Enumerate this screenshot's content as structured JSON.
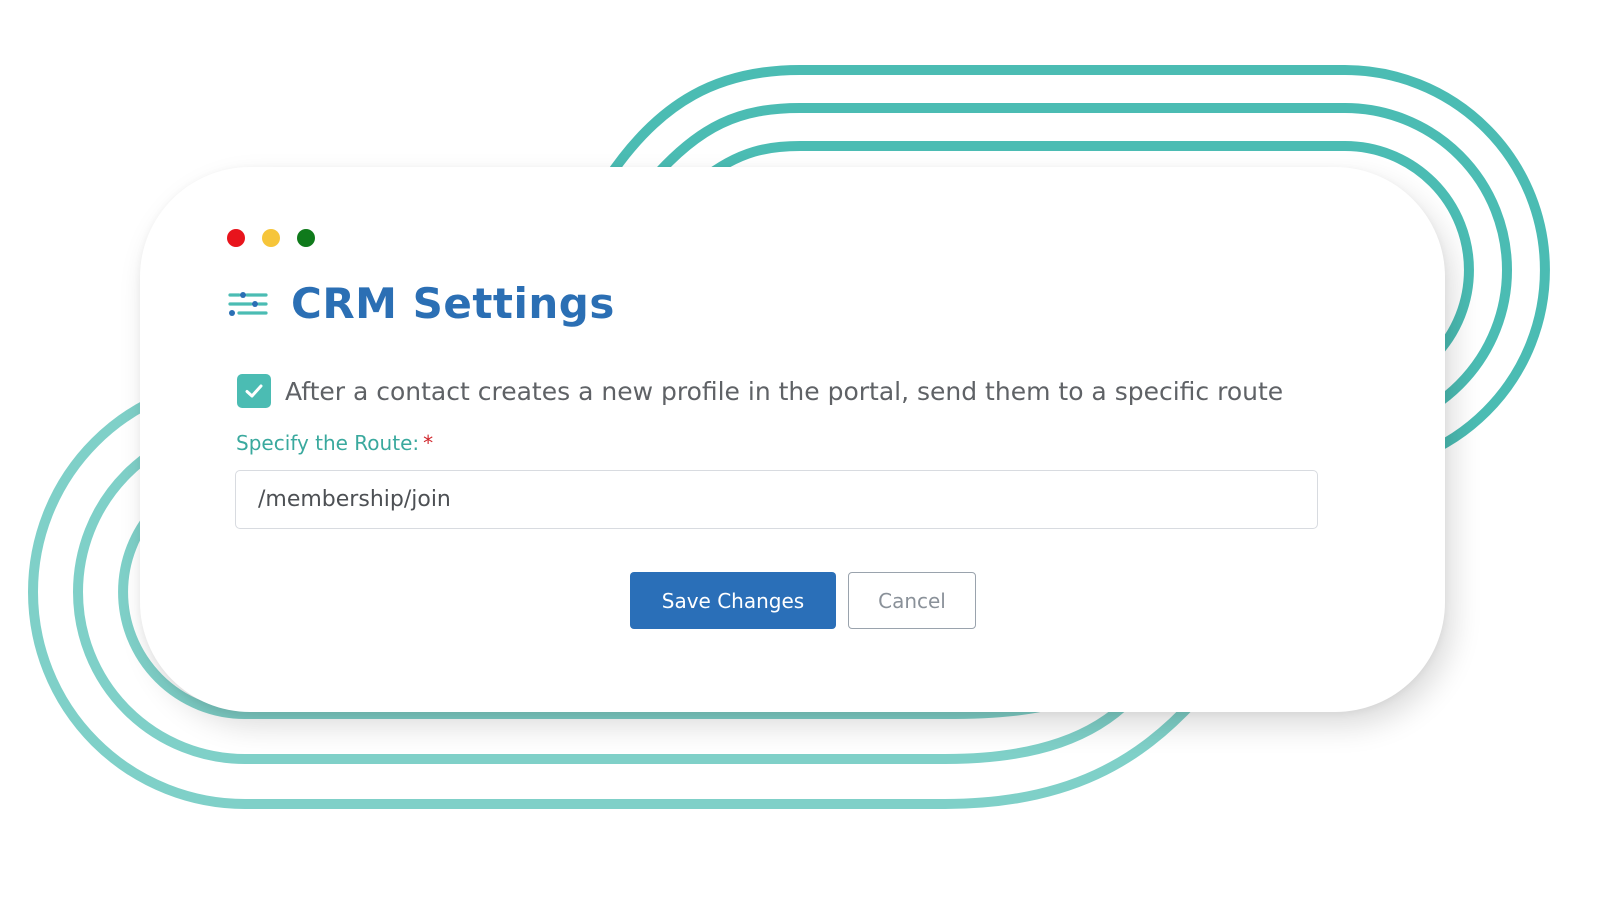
{
  "window": {
    "controls": [
      {
        "name": "close",
        "color": "#e8141c"
      },
      {
        "name": "minimize",
        "color": "#f6c53a"
      },
      {
        "name": "maximize",
        "color": "#0f7a1b"
      }
    ]
  },
  "header": {
    "icon": "sliders-icon",
    "title": "CRM Settings"
  },
  "form": {
    "checkbox": {
      "checked": true,
      "label": "After a contact creates a new profile in the portal, send them to a specific route"
    },
    "route": {
      "label": "Specify the Route:",
      "required_mark": "*",
      "value": "/membership/join"
    }
  },
  "actions": {
    "save_label": "Save Changes",
    "cancel_label": "Cancel"
  },
  "colors": {
    "accent_teal": "#4bbcb3",
    "title_blue": "#2b6fb4",
    "save_blue": "#2a6fb8",
    "required_red": "#d0252b"
  }
}
